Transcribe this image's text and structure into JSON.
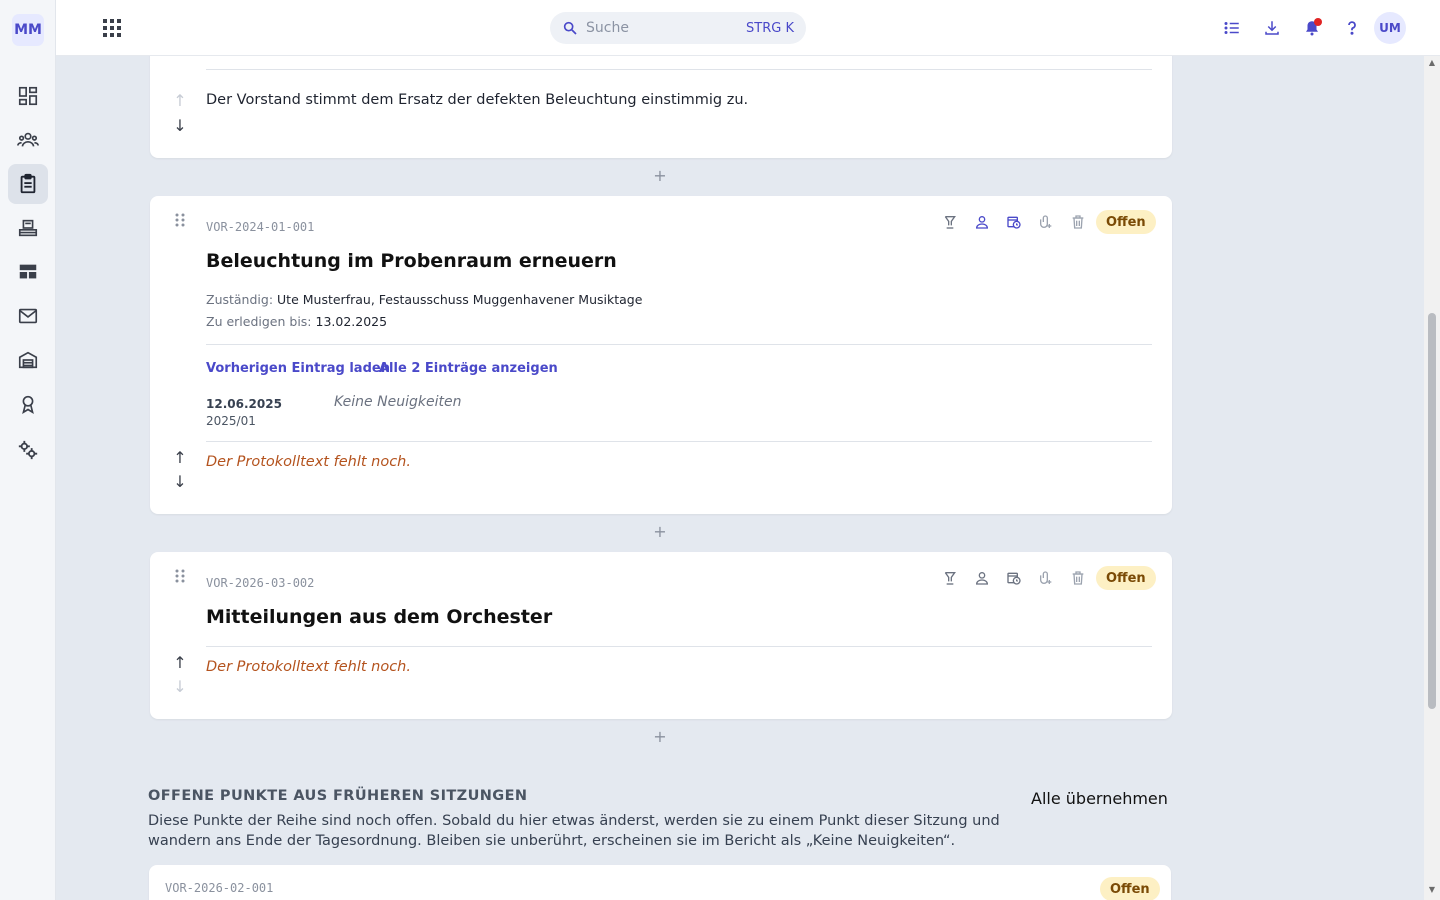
{
  "logo": "MM",
  "search": {
    "placeholder": "Suche",
    "shortcut": "STRG K"
  },
  "user": {
    "initials": "UM"
  },
  "sidebar": {
    "items": [
      {
        "icon": "dashboard-icon"
      },
      {
        "icon": "people-icon"
      },
      {
        "icon": "clipboard-icon",
        "active": true
      },
      {
        "icon": "bank-icon"
      },
      {
        "icon": "table-icon"
      },
      {
        "icon": "mail-icon"
      },
      {
        "icon": "warehouse-icon"
      },
      {
        "icon": "award-icon"
      },
      {
        "icon": "settings-icon"
      }
    ]
  },
  "topbar": {
    "icons": [
      "list-icon",
      "download-icon",
      "bell-icon",
      "help-icon"
    ]
  },
  "card0": {
    "text": "Der Vorstand stimmt dem Ersatz der defekten Beleuchtung einstimmig zu."
  },
  "card1": {
    "code": "VOR-2024-01-001",
    "title": "Beleuchtung im Probenraum erneuern",
    "status": "Offen",
    "responsible_label": "Zuständig:",
    "responsible_value": "Ute Musterfrau, Festausschuss Muggenhavener Musiktage",
    "due_label": "Zu erledigen bis:",
    "due_value": "13.02.2025",
    "link_prev": "Vorherigen Eintrag laden",
    "link_all": "Alle 2 Einträge anzeigen",
    "entry": {
      "date": "12.06.2025",
      "session": "2025/01",
      "text": "Keine Neuigkeiten"
    },
    "missing": "Der Protokolltext fehlt noch."
  },
  "card2": {
    "code": "VOR-2026-03-002",
    "title": "Mitteilungen aus dem Orchester",
    "status": "Offen",
    "missing": "Der Protokolltext fehlt noch."
  },
  "plus": "+",
  "open_section": {
    "title": "OFFENE PUNKTE AUS FRÜHEREN SITZUNGEN",
    "description": "Diese Punkte der Reihe sind noch offen. Sobald du hier etwas änderst, werden sie zu einem Punkt dieser Sitzung und wandern ans Ende der Tagesordnung. Bleiben sie unberührt, erscheinen sie im Bericht als „Keine Neuigkeiten“.",
    "adopt_all": "Alle übernehmen"
  },
  "card3": {
    "code": "VOR-2026-02-001",
    "status": "Offen"
  },
  "colors": {
    "accent": "#4a49c9",
    "badge_bg": "#fdf0c4",
    "missing_text": "#b4531e"
  }
}
